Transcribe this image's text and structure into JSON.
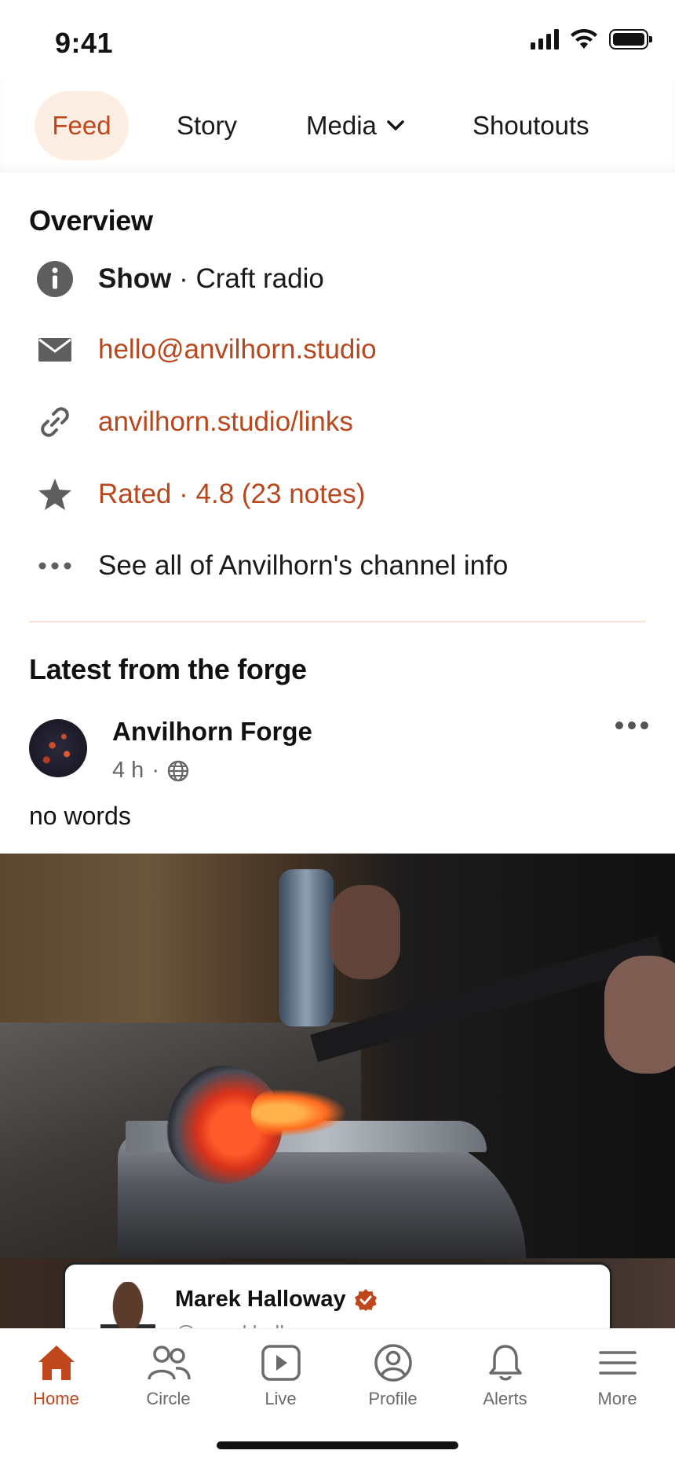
{
  "status_bar": {
    "time": "9:41"
  },
  "tabs": [
    {
      "label": "Feed",
      "active": true
    },
    {
      "label": "Story"
    },
    {
      "label": "Media"
    },
    {
      "label": "Shoutouts"
    }
  ],
  "overview": {
    "title": "Overview",
    "category_label": "Show",
    "category_value": "· Craft radio",
    "email": "hello@anvilhorn.studio",
    "link": "anvilhorn.studio/links",
    "rating": "Rated · 4.8 (23 notes)",
    "see_all": "See all of Anvilhorn's channel info"
  },
  "latest": {
    "title": "Latest from the forge",
    "post": {
      "author": "Anvilhorn Forge",
      "time": "4 h",
      "separator": "·",
      "text": "no words"
    }
  },
  "profile_card": {
    "name": "Marek Halloway",
    "handle": "@marekhalloway",
    "verified": true
  },
  "bottom_nav": [
    {
      "label": "Home",
      "icon": "home-icon",
      "active": true
    },
    {
      "label": "Circle",
      "icon": "people-icon"
    },
    {
      "label": "Live",
      "icon": "play-icon"
    },
    {
      "label": "Profile",
      "icon": "user-circle-icon"
    },
    {
      "label": "Alerts",
      "icon": "bell-icon"
    },
    {
      "label": "More",
      "icon": "menu-icon"
    }
  ],
  "colors": {
    "accent": "#c0461b",
    "tab_active_bg": "#fdeee4",
    "icon_gray": "#5e5e5e"
  }
}
